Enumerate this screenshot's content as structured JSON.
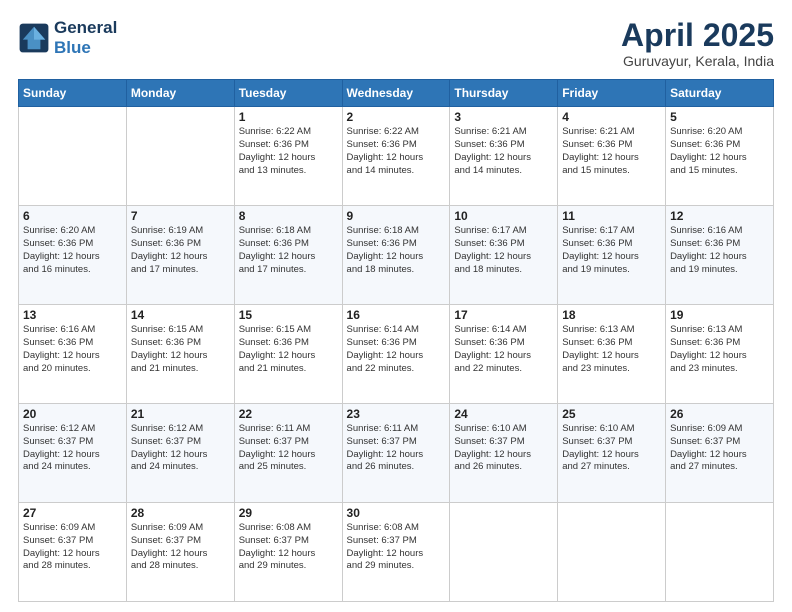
{
  "header": {
    "logo_line1": "General",
    "logo_line2": "Blue",
    "title": "April 2025",
    "location": "Guruvayur, Kerala, India"
  },
  "weekdays": [
    "Sunday",
    "Monday",
    "Tuesday",
    "Wednesday",
    "Thursday",
    "Friday",
    "Saturday"
  ],
  "weeks": [
    [
      {
        "day": "",
        "info": ""
      },
      {
        "day": "",
        "info": ""
      },
      {
        "day": "1",
        "info": "Sunrise: 6:22 AM\nSunset: 6:36 PM\nDaylight: 12 hours\nand 13 minutes."
      },
      {
        "day": "2",
        "info": "Sunrise: 6:22 AM\nSunset: 6:36 PM\nDaylight: 12 hours\nand 14 minutes."
      },
      {
        "day": "3",
        "info": "Sunrise: 6:21 AM\nSunset: 6:36 PM\nDaylight: 12 hours\nand 14 minutes."
      },
      {
        "day": "4",
        "info": "Sunrise: 6:21 AM\nSunset: 6:36 PM\nDaylight: 12 hours\nand 15 minutes."
      },
      {
        "day": "5",
        "info": "Sunrise: 6:20 AM\nSunset: 6:36 PM\nDaylight: 12 hours\nand 15 minutes."
      }
    ],
    [
      {
        "day": "6",
        "info": "Sunrise: 6:20 AM\nSunset: 6:36 PM\nDaylight: 12 hours\nand 16 minutes."
      },
      {
        "day": "7",
        "info": "Sunrise: 6:19 AM\nSunset: 6:36 PM\nDaylight: 12 hours\nand 17 minutes."
      },
      {
        "day": "8",
        "info": "Sunrise: 6:18 AM\nSunset: 6:36 PM\nDaylight: 12 hours\nand 17 minutes."
      },
      {
        "day": "9",
        "info": "Sunrise: 6:18 AM\nSunset: 6:36 PM\nDaylight: 12 hours\nand 18 minutes."
      },
      {
        "day": "10",
        "info": "Sunrise: 6:17 AM\nSunset: 6:36 PM\nDaylight: 12 hours\nand 18 minutes."
      },
      {
        "day": "11",
        "info": "Sunrise: 6:17 AM\nSunset: 6:36 PM\nDaylight: 12 hours\nand 19 minutes."
      },
      {
        "day": "12",
        "info": "Sunrise: 6:16 AM\nSunset: 6:36 PM\nDaylight: 12 hours\nand 19 minutes."
      }
    ],
    [
      {
        "day": "13",
        "info": "Sunrise: 6:16 AM\nSunset: 6:36 PM\nDaylight: 12 hours\nand 20 minutes."
      },
      {
        "day": "14",
        "info": "Sunrise: 6:15 AM\nSunset: 6:36 PM\nDaylight: 12 hours\nand 21 minutes."
      },
      {
        "day": "15",
        "info": "Sunrise: 6:15 AM\nSunset: 6:36 PM\nDaylight: 12 hours\nand 21 minutes."
      },
      {
        "day": "16",
        "info": "Sunrise: 6:14 AM\nSunset: 6:36 PM\nDaylight: 12 hours\nand 22 minutes."
      },
      {
        "day": "17",
        "info": "Sunrise: 6:14 AM\nSunset: 6:36 PM\nDaylight: 12 hours\nand 22 minutes."
      },
      {
        "day": "18",
        "info": "Sunrise: 6:13 AM\nSunset: 6:36 PM\nDaylight: 12 hours\nand 23 minutes."
      },
      {
        "day": "19",
        "info": "Sunrise: 6:13 AM\nSunset: 6:36 PM\nDaylight: 12 hours\nand 23 minutes."
      }
    ],
    [
      {
        "day": "20",
        "info": "Sunrise: 6:12 AM\nSunset: 6:37 PM\nDaylight: 12 hours\nand 24 minutes."
      },
      {
        "day": "21",
        "info": "Sunrise: 6:12 AM\nSunset: 6:37 PM\nDaylight: 12 hours\nand 24 minutes."
      },
      {
        "day": "22",
        "info": "Sunrise: 6:11 AM\nSunset: 6:37 PM\nDaylight: 12 hours\nand 25 minutes."
      },
      {
        "day": "23",
        "info": "Sunrise: 6:11 AM\nSunset: 6:37 PM\nDaylight: 12 hours\nand 26 minutes."
      },
      {
        "day": "24",
        "info": "Sunrise: 6:10 AM\nSunset: 6:37 PM\nDaylight: 12 hours\nand 26 minutes."
      },
      {
        "day": "25",
        "info": "Sunrise: 6:10 AM\nSunset: 6:37 PM\nDaylight: 12 hours\nand 27 minutes."
      },
      {
        "day": "26",
        "info": "Sunrise: 6:09 AM\nSunset: 6:37 PM\nDaylight: 12 hours\nand 27 minutes."
      }
    ],
    [
      {
        "day": "27",
        "info": "Sunrise: 6:09 AM\nSunset: 6:37 PM\nDaylight: 12 hours\nand 28 minutes."
      },
      {
        "day": "28",
        "info": "Sunrise: 6:09 AM\nSunset: 6:37 PM\nDaylight: 12 hours\nand 28 minutes."
      },
      {
        "day": "29",
        "info": "Sunrise: 6:08 AM\nSunset: 6:37 PM\nDaylight: 12 hours\nand 29 minutes."
      },
      {
        "day": "30",
        "info": "Sunrise: 6:08 AM\nSunset: 6:37 PM\nDaylight: 12 hours\nand 29 minutes."
      },
      {
        "day": "",
        "info": ""
      },
      {
        "day": "",
        "info": ""
      },
      {
        "day": "",
        "info": ""
      }
    ]
  ]
}
